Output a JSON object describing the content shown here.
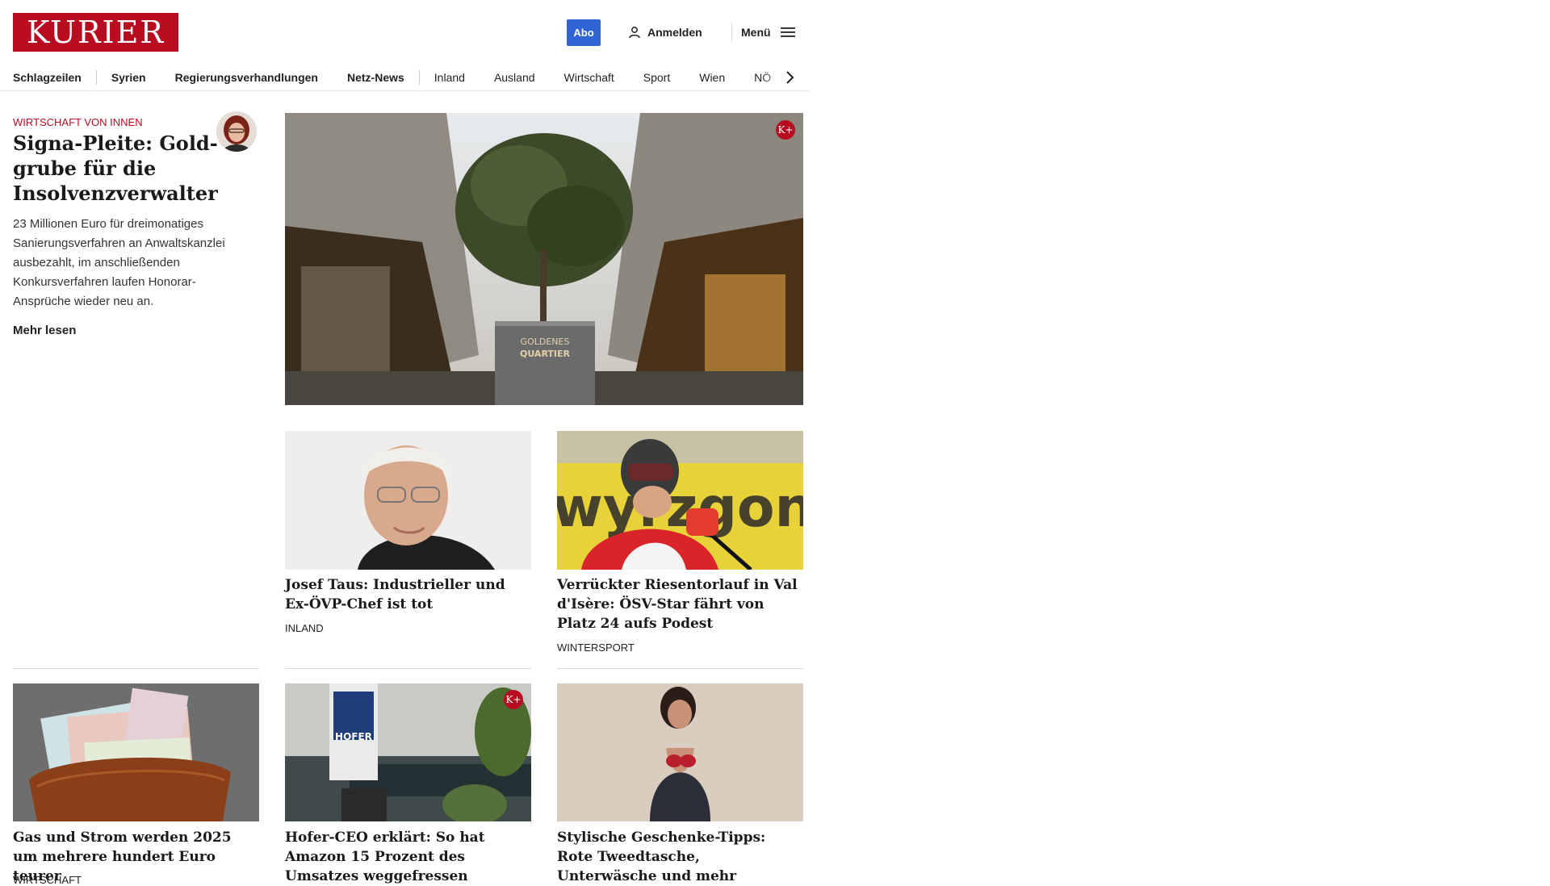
{
  "header": {
    "logo_text": "KURIER",
    "abo_label": "Abo",
    "login_label": "Anmelden",
    "menu_label": "Menü"
  },
  "nav": {
    "items": [
      {
        "label": "Schlagzeilen"
      },
      {
        "label": "Syrien"
      },
      {
        "label": "Regierungsverhandlungen"
      },
      {
        "label": "Netz-News"
      },
      {
        "label": "Inland"
      },
      {
        "label": "Ausland"
      },
      {
        "label": "Wirtschaft"
      },
      {
        "label": "Sport"
      },
      {
        "label": "Wien"
      },
      {
        "label": "NÖ"
      }
    ]
  },
  "lead": {
    "kicker": "Wirtschaft von innen",
    "title": "Signa-Pleite: Gold-grube für die Insolvenzverwalter",
    "text": "23 Millionen Euro für dreimonatiges Sanierungsverfahren an Anwaltskanzlei ausbezahlt, im anschließenden Konkursverfahren laufen Honorar-Ansprüche wieder neu an.",
    "more_label": "Mehr lesen",
    "image_text": [
      "GOLDENES",
      "QUARTIER"
    ],
    "badge": "K+"
  },
  "cards": [
    {
      "title": "Josef Taus: Industrieller und Ex-ÖVP-Chef ist tot",
      "category": "Inland"
    },
    {
      "title": "Verrückter Riesentorlauf in Val d'Isère: ÖSV-Star fährt von Platz 24 aufs Podest",
      "category": "Wintersport",
      "image_text": "wyrzgonc."
    },
    {
      "title": "Gas und Strom werden 2025 um mehrere hundert Euro teurer",
      "category": "Wirtschaft"
    },
    {
      "title": "Hofer-CEO erklärt: So hat Amazon 15 Prozent des Umsatzes weggefressen",
      "category": "",
      "badge": "K+",
      "image_text": "HOFER"
    },
    {
      "title": "Stylische Geschenke-Tipps: Rote Tweedtasche, Unterwäsche und mehr",
      "category": ""
    }
  ],
  "colors": {
    "brand": "#b80d20",
    "abo": "#2f64d6"
  }
}
